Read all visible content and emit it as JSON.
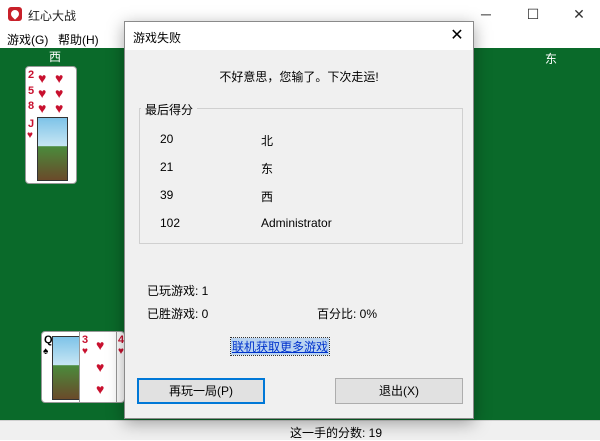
{
  "window": {
    "title": "红心大战",
    "minimize": "─",
    "maximize": "☐",
    "close": "✕"
  },
  "menu": {
    "game": "游戏(G)",
    "help": "帮助(H)"
  },
  "players": {
    "west": "西",
    "east": "东"
  },
  "west_hand": {
    "ranks": [
      "2",
      "5",
      "8",
      "J"
    ]
  },
  "south_hand": {
    "ranks": [
      "Q",
      "3",
      "4"
    ]
  },
  "statusbar": {
    "score_text": "这一手的分数: 19"
  },
  "dialog": {
    "title": "游戏失败",
    "close": "✕",
    "message": "不好意思，您输了。下次走运!",
    "group_label": "最后得分",
    "scores": [
      {
        "value": "20",
        "name": "北"
      },
      {
        "value": "21",
        "name": "东"
      },
      {
        "value": "39",
        "name": "西"
      },
      {
        "value": "102",
        "name": "Administrator"
      }
    ],
    "games_played": "已玩游戏: 1",
    "games_won": "已胜游戏: 0",
    "percentage": "百分比: 0%",
    "online_link": "联机获取更多游戏",
    "play_again": "再玩一局(P)",
    "exit": "退出(X)"
  },
  "colors": {
    "table_green": "#0a6a2a",
    "heart_red": "#c8102e",
    "focus_blue": "#0078d7"
  }
}
